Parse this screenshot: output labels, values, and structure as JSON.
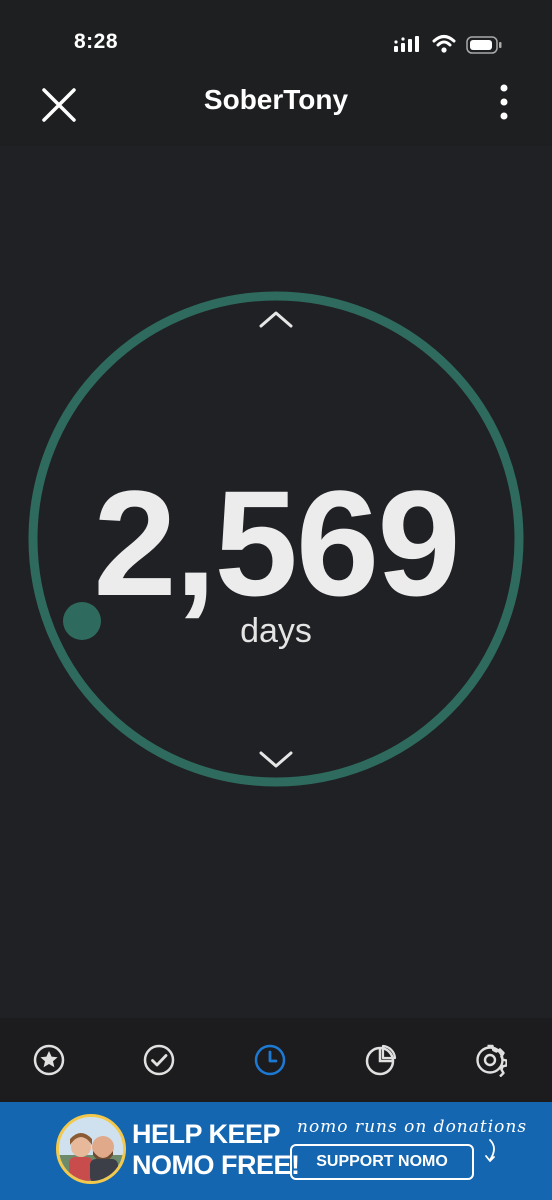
{
  "status_bar": {
    "time": "8:28",
    "icons": [
      "signal-icon",
      "wifi-icon",
      "battery-icon"
    ]
  },
  "app_bar": {
    "title": "SoberTony",
    "left_icon": "close-icon",
    "right_icon": "more-vert-icon"
  },
  "counter": {
    "value": "2,569",
    "unit": "days",
    "ring_color": "#2e6b5e",
    "controls": [
      "chevron-up-icon",
      "chevron-down-icon"
    ]
  },
  "tab_bar": {
    "active_color": "#1c7ad4",
    "tabs": [
      {
        "icon": "star-icon",
        "active": false
      },
      {
        "icon": "check-circle-icon",
        "active": false
      },
      {
        "icon": "clock-icon",
        "active": true
      },
      {
        "icon": "pie-chart-icon",
        "active": false
      },
      {
        "icon": "settings-icon",
        "active": false
      }
    ]
  },
  "banner": {
    "headline_line1": "HELP KEEP",
    "headline_line2": "NOMO FREE!",
    "tagline": "nomo runs on donations",
    "button_label": "SUPPORT NOMO",
    "background": "#1466b0"
  }
}
